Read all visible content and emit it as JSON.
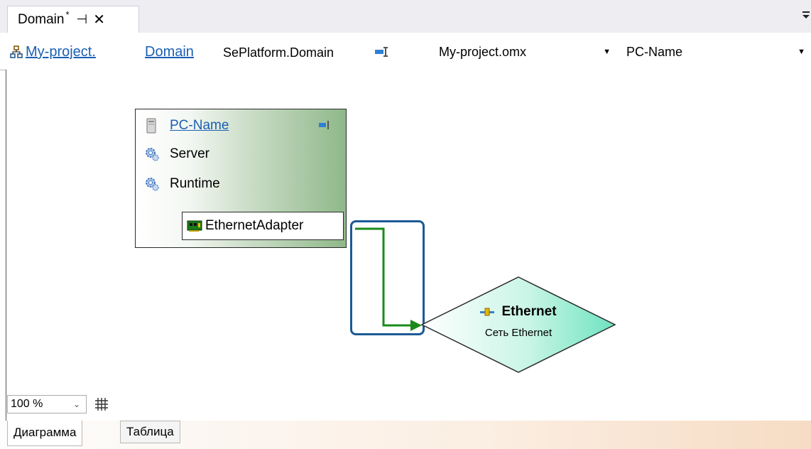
{
  "tab": {
    "title": "Domain",
    "modified_marker": "*",
    "pin_icon": "pin-icon",
    "close_icon": "close-icon"
  },
  "navbar": {
    "icon": "network-icon",
    "crumb_project": "My-project.",
    "crumb_domain": "Domain",
    "type_name": "SePlatform.Domain",
    "file_combo_value": "My-project.omx",
    "node_combo_value": "PC-Name"
  },
  "diagram": {
    "node": {
      "title": "PC-Name",
      "items": [
        {
          "label": "Server",
          "icon": "gear-icon"
        },
        {
          "label": "Runtime",
          "icon": "gear-icon"
        }
      ],
      "port_label": "EthernetAdapter",
      "port_icon": "network-card-icon"
    },
    "network": {
      "title": "Ethernet",
      "subtitle": "Сеть Ethernet",
      "icon": "network-link-icon"
    },
    "colors": {
      "connector": "#1a8a1a",
      "selection": "#1c5a96",
      "diamond_fill": "#7fe8c8"
    }
  },
  "zoom": {
    "value": "100 %"
  },
  "bottom_tabs": [
    {
      "label": "Диаграмма",
      "active": true
    },
    {
      "label": "Таблица",
      "active": false
    }
  ]
}
